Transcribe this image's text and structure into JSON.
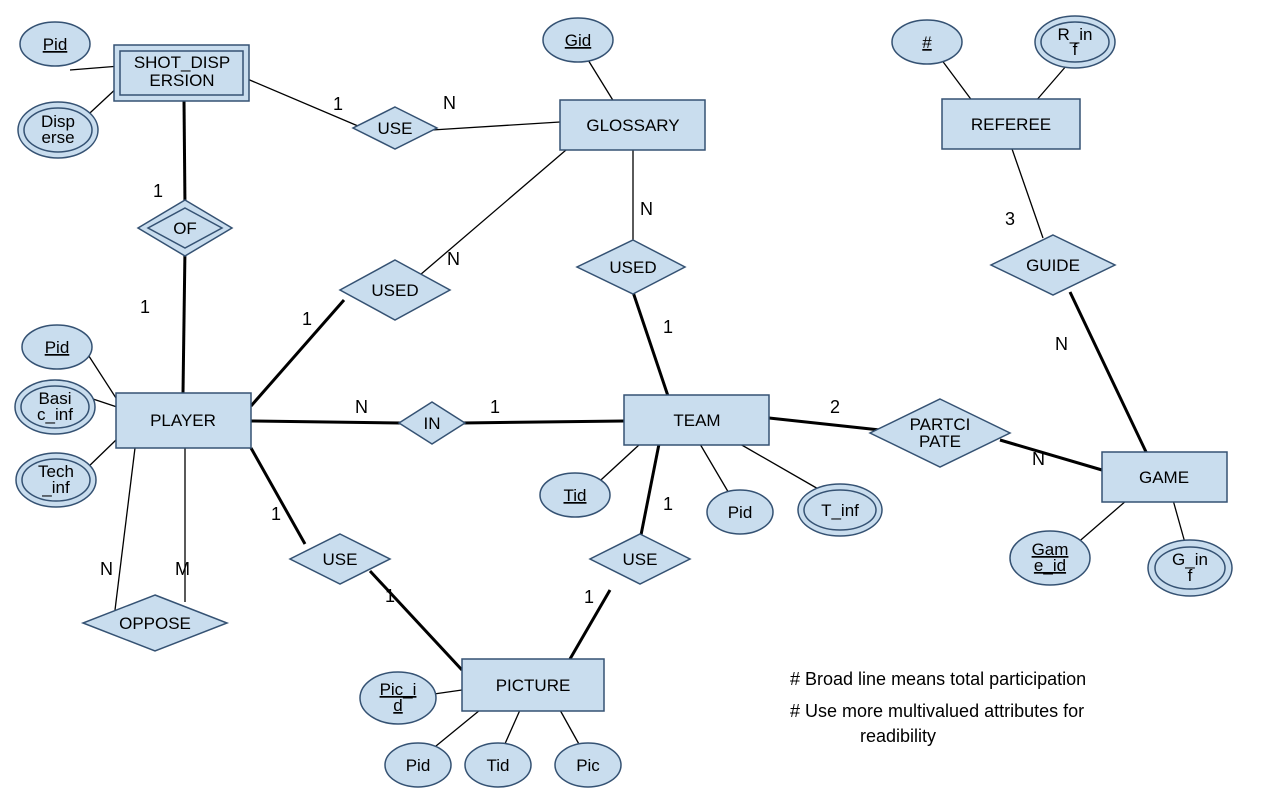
{
  "entities": {
    "shot_dispersion": "SHOT_DISP",
    "shot_dispersion2": "ERSION",
    "glossary": "GLOSSARY",
    "referee": "REFEREE",
    "player": "PLAYER",
    "team": "TEAM",
    "game": "GAME",
    "picture": "PICTURE"
  },
  "attributes": {
    "sd_pid": "Pid",
    "sd_disperse1": "Disp",
    "sd_disperse2": "erse",
    "glossary_gid": "Gid",
    "ref_hash": "#",
    "ref_rinf1": "R_in",
    "ref_rinf2": "f",
    "player_pid": "Pid",
    "player_basic1": "Basi",
    "player_basic2": "c_inf",
    "player_tech1": "Tech",
    "player_tech2": "_inf",
    "team_tid": "Tid",
    "team_pid": "Pid",
    "team_tinf": "T_inf",
    "game_id1": "Gam",
    "game_id2": "e_id",
    "game_ginf1": "G_in",
    "game_ginf2": "f",
    "pic_id1": "Pic_i",
    "pic_id2": "d",
    "pic_pid": "Pid",
    "pic_tid": "Tid",
    "pic_pic": "Pic"
  },
  "relationships": {
    "use1": "USE",
    "of": "OF",
    "used1": "USED",
    "used2": "USED",
    "in": "IN",
    "guide": "GUIDE",
    "participate1": "PARTCI",
    "participate2": "PATE",
    "oppose": "OPPOSE",
    "use2": "USE",
    "use3": "USE"
  },
  "cardinalities": {
    "use1_sd": "1",
    "use1_gl": "N",
    "of_sd": "1",
    "of_pl": "1",
    "used1_pl": "1",
    "used1_gl": "N",
    "used2_gl": "N",
    "used2_tm": "1",
    "in_pl": "N",
    "in_tm": "1",
    "guide_ref": "3",
    "guide_gm": "N",
    "part_tm": "2",
    "part_gm": "N",
    "oppose_n": "N",
    "oppose_m": "M",
    "use2_pl": "1",
    "use2_pic": "1",
    "use3_tm": "1",
    "use3_pic": "1"
  },
  "notes": {
    "n1": "# Broad line means  total participation",
    "n2": "# Use more multivalued attributes for",
    "n3": "readibility"
  }
}
